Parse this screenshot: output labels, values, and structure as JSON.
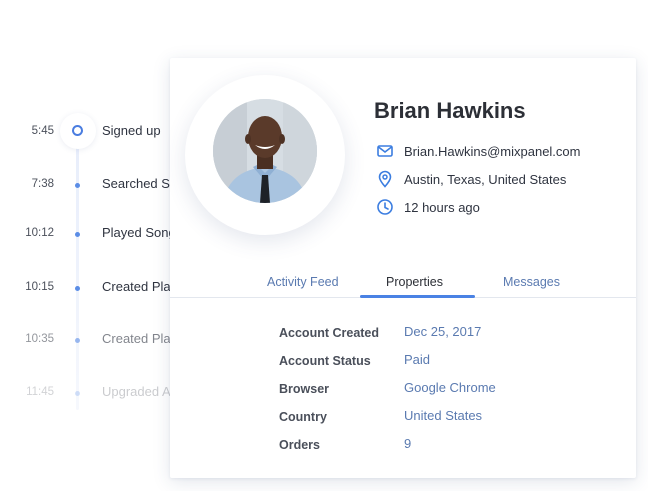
{
  "timeline": {
    "events": [
      {
        "time": "5:45",
        "label": "Signed up",
        "opacity": 1
      },
      {
        "time": "7:38",
        "label": "Searched S",
        "opacity": 1
      },
      {
        "time": "10:12",
        "label": "Played Song",
        "opacity": 1
      },
      {
        "time": "10:15",
        "label": "Created Pla",
        "opacity": 1
      },
      {
        "time": "10:35",
        "label": "Created Pla",
        "opacity": 0.6
      },
      {
        "time": "11:45",
        "label": "Upgraded A",
        "opacity": 0.25
      }
    ]
  },
  "profile": {
    "name": "Brian Hawkins",
    "email": "Brian.Hawkins@mixpanel.com",
    "location": "Austin, Texas, United States",
    "last_seen": "12 hours ago",
    "icons": {
      "email": "mail-icon",
      "location": "location-pin-icon",
      "time": "clock-icon"
    }
  },
  "tabs": [
    "Activity Feed",
    "Properties",
    "Messages"
  ],
  "active_tab": "Properties",
  "properties": [
    {
      "label": "Account Created",
      "value": "Dec 25, 2017"
    },
    {
      "label": "Account Status",
      "value": "Paid"
    },
    {
      "label": "Browser",
      "value": "Google Chrome"
    },
    {
      "label": "Country",
      "value": "United States"
    },
    {
      "label": "Orders",
      "value": "9"
    }
  ],
  "colors": {
    "accent": "#4a82e4",
    "link_text": "#5a7ab0",
    "text": "#2c2f36"
  }
}
